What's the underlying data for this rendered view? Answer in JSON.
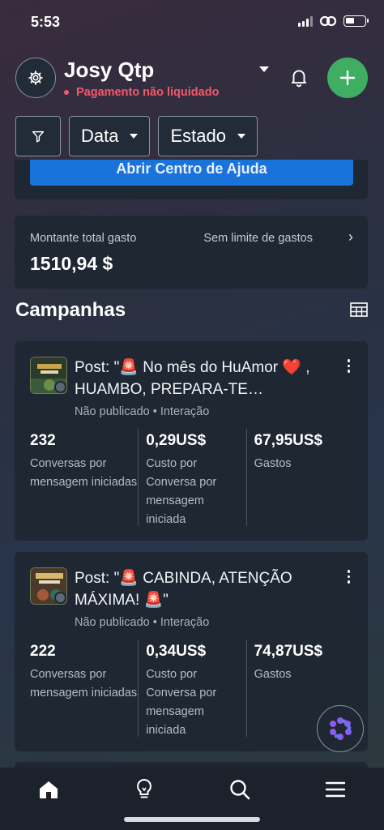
{
  "status_bar": {
    "time": "5:53"
  },
  "header": {
    "account_name": "Josy Qtp",
    "account_status": "Pagamento não liquidado"
  },
  "filters": {
    "date_label": "Data",
    "state_label": "Estado"
  },
  "help": {
    "button_label": "Abrir Centro de Ajuda"
  },
  "spend": {
    "label": "Montante total gasto",
    "limit_label": "Sem limite de gastos",
    "value": "1510,94 $"
  },
  "campaigns": {
    "section_title": "Campanhas",
    "items": [
      {
        "title": "Post: \"🚨 No mês do HuAmor ❤️ , HUAMBO, PREPARA-TE…",
        "meta": "Não publicado • Interação",
        "metrics": [
          {
            "value": "232",
            "label": "Conversas por mensagem iniciadas"
          },
          {
            "value": "0,29US$",
            "label": "Custo por Conversa por mensagem iniciada"
          },
          {
            "value": "67,95US$",
            "label": "Gastos"
          }
        ]
      },
      {
        "title": "Post: \"🚨 CABINDA, ATENÇÃO MÁXIMA! 🚨\"",
        "meta": "Não publicado • Interação",
        "metrics": [
          {
            "value": "222",
            "label": "Conversas por mensagem iniciadas"
          },
          {
            "value": "0,34US$",
            "label": "Custo por Conversa por mensagem iniciada"
          },
          {
            "value": "74,87US$",
            "label": "Gastos"
          }
        ]
      }
    ]
  },
  "colors": {
    "accent_green": "#3fae63",
    "status_red": "#f05a6a",
    "primary_blue": "#1a73d9",
    "card_bg": "#1f2732"
  },
  "icons": {
    "settings": "gear-icon",
    "notifications": "bell-icon",
    "add": "plus-icon",
    "filter": "funnel-icon",
    "table": "table-icon",
    "more": "kebab-icon",
    "assistant": "flower-icon",
    "tabs": [
      "home-icon",
      "lightbulb-icon",
      "search-icon",
      "menu-icon"
    ]
  }
}
